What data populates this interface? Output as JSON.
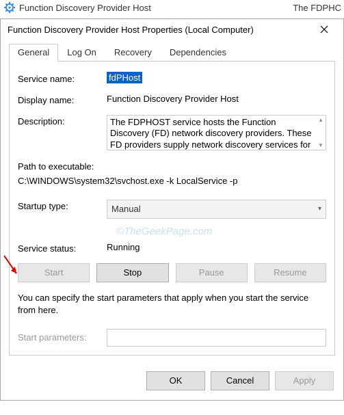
{
  "top": {
    "service_name": "Function Discovery Provider Host",
    "right_fragment": "The FDPHC"
  },
  "dialog": {
    "title": "Function Discovery Provider Host Properties (Local Computer)"
  },
  "tabs": {
    "general": "General",
    "logon": "Log On",
    "recovery": "Recovery",
    "dependencies": "Dependencies"
  },
  "labels": {
    "service_name": "Service name:",
    "display_name": "Display name:",
    "description": "Description:",
    "path": "Path to executable:",
    "startup_type": "Startup type:",
    "service_status": "Service status:",
    "start_parameters": "Start parameters:"
  },
  "values": {
    "service_name": "fdPHost",
    "display_name": "Function Discovery Provider Host",
    "description": "The FDPHOST service hosts the Function Discovery (FD) network discovery providers. These FD providers supply network discovery services for the Simple",
    "path": "C:\\WINDOWS\\system32\\svchost.exe -k LocalService -p",
    "startup_type": "Manual",
    "service_status": "Running"
  },
  "buttons": {
    "start": "Start",
    "stop": "Stop",
    "pause": "Pause",
    "resume": "Resume",
    "ok": "OK",
    "cancel": "Cancel",
    "apply": "Apply"
  },
  "hint": "You can specify the start parameters that apply when you start the service from here.",
  "watermark": "©TheGeekPage.com"
}
